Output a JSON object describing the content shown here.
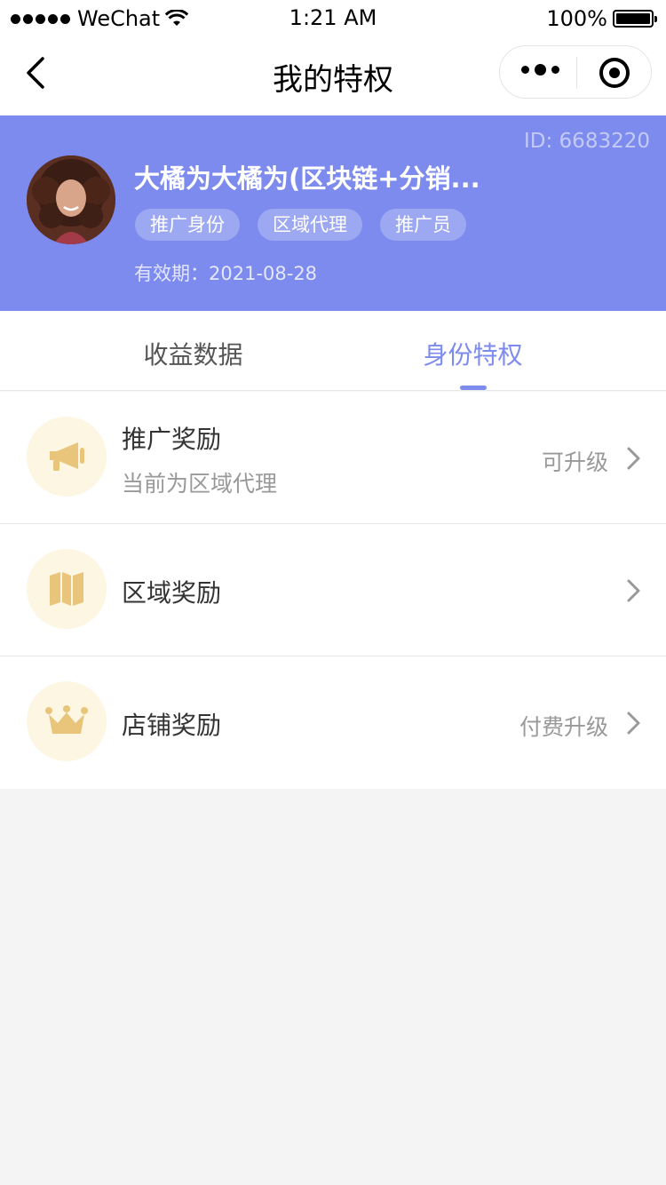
{
  "status_bar": {
    "carrier": "WeChat",
    "time": "1:21 AM",
    "battery": "100%"
  },
  "nav": {
    "title": "我的特权"
  },
  "profile": {
    "id_text": "ID: 6683220",
    "name": "大橘为大橘为(区块链+分销...",
    "tags": [
      "推广身份",
      "区域代理",
      "推广员"
    ],
    "validity": "有效期：2021-08-28"
  },
  "tabs": [
    {
      "label": "收益数据",
      "active": false
    },
    {
      "label": "身份特权",
      "active": true
    }
  ],
  "privileges": [
    {
      "icon": "megaphone-icon",
      "title": "推广奖励",
      "subtitle": "当前为区域代理",
      "action": "可升级"
    },
    {
      "icon": "map-icon",
      "title": "区域奖励",
      "subtitle": "",
      "action": ""
    },
    {
      "icon": "crown-icon",
      "title": "店铺奖励",
      "subtitle": "",
      "action": "付费升级"
    }
  ],
  "colors": {
    "accent": "#7d8bee",
    "icon_bg": "#fcf6e2",
    "icon_fg": "#e8c57a"
  }
}
